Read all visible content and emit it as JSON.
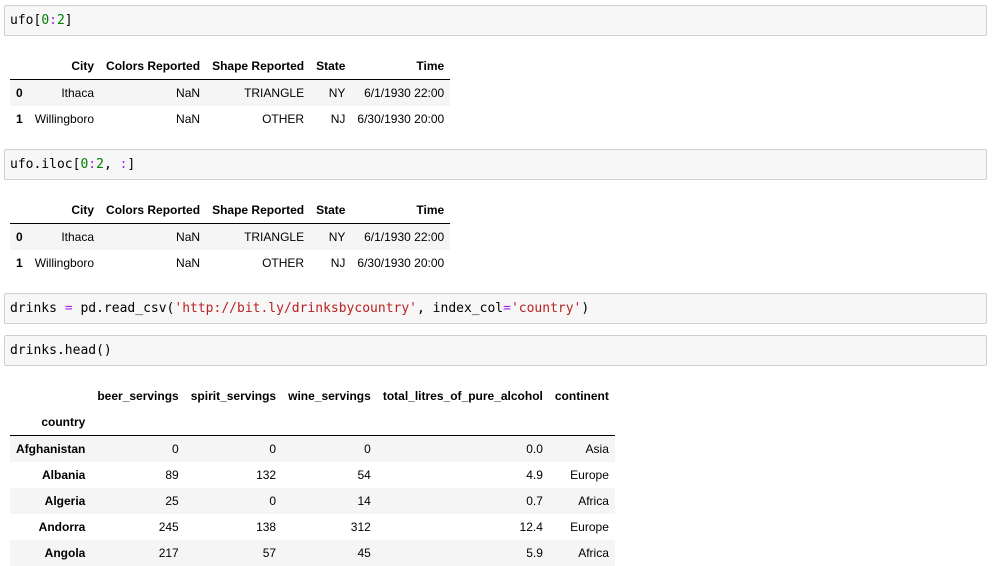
{
  "cells": [
    {
      "tokens": [
        {
          "t": "ufo[",
          "c": "txt"
        },
        {
          "t": "0",
          "c": "num"
        },
        {
          "t": ":",
          "c": "op"
        },
        {
          "t": "2",
          "c": "num"
        },
        {
          "t": "]",
          "c": "txt"
        }
      ]
    },
    {
      "tokens": [
        {
          "t": "ufo.iloc[",
          "c": "txt"
        },
        {
          "t": "0",
          "c": "num"
        },
        {
          "t": ":",
          "c": "op"
        },
        {
          "t": "2",
          "c": "num"
        },
        {
          "t": ", ",
          "c": "txt"
        },
        {
          "t": ":",
          "c": "op"
        },
        {
          "t": "]",
          "c": "txt"
        }
      ]
    },
    {
      "tokens": [
        {
          "t": "drinks ",
          "c": "txt"
        },
        {
          "t": "=",
          "c": "op"
        },
        {
          "t": " pd.read_csv(",
          "c": "txt"
        },
        {
          "t": "'http://bit.ly/drinksbycountry'",
          "c": "str"
        },
        {
          "t": ", index_col",
          "c": "txt"
        },
        {
          "t": "=",
          "c": "op"
        },
        {
          "t": "'country'",
          "c": "str"
        },
        {
          "t": ")",
          "c": "txt"
        }
      ]
    },
    {
      "tokens": [
        {
          "t": "drinks.head()",
          "c": "txt"
        }
      ]
    }
  ],
  "ufo_table": {
    "columns": [
      "City",
      "Colors Reported",
      "Shape Reported",
      "State",
      "Time"
    ],
    "rows": [
      {
        "index": "0",
        "cells": [
          "Ithaca",
          "NaN",
          "TRIANGLE",
          "NY",
          "6/1/1930 22:00"
        ]
      },
      {
        "index": "1",
        "cells": [
          "Willingboro",
          "NaN",
          "OTHER",
          "NJ",
          "6/30/1930 20:00"
        ]
      }
    ]
  },
  "ufo_iloc_table": {
    "columns": [
      "City",
      "Colors Reported",
      "Shape Reported",
      "State",
      "Time"
    ],
    "rows": [
      {
        "index": "0",
        "cells": [
          "Ithaca",
          "NaN",
          "TRIANGLE",
          "NY",
          "6/1/1930 22:00"
        ]
      },
      {
        "index": "1",
        "cells": [
          "Willingboro",
          "NaN",
          "OTHER",
          "NJ",
          "6/30/1930 20:00"
        ]
      }
    ]
  },
  "drinks_table": {
    "index_name": "country",
    "columns": [
      "beer_servings",
      "spirit_servings",
      "wine_servings",
      "total_litres_of_pure_alcohol",
      "continent"
    ],
    "rows": [
      {
        "index": "Afghanistan",
        "cells": [
          "0",
          "0",
          "0",
          "0.0",
          "Asia"
        ]
      },
      {
        "index": "Albania",
        "cells": [
          "89",
          "132",
          "54",
          "4.9",
          "Europe"
        ]
      },
      {
        "index": "Algeria",
        "cells": [
          "25",
          "0",
          "14",
          "0.7",
          "Africa"
        ]
      },
      {
        "index": "Andorra",
        "cells": [
          "245",
          "138",
          "312",
          "12.4",
          "Europe"
        ]
      },
      {
        "index": "Angola",
        "cells": [
          "217",
          "57",
          "45",
          "5.9",
          "Africa"
        ]
      }
    ]
  }
}
